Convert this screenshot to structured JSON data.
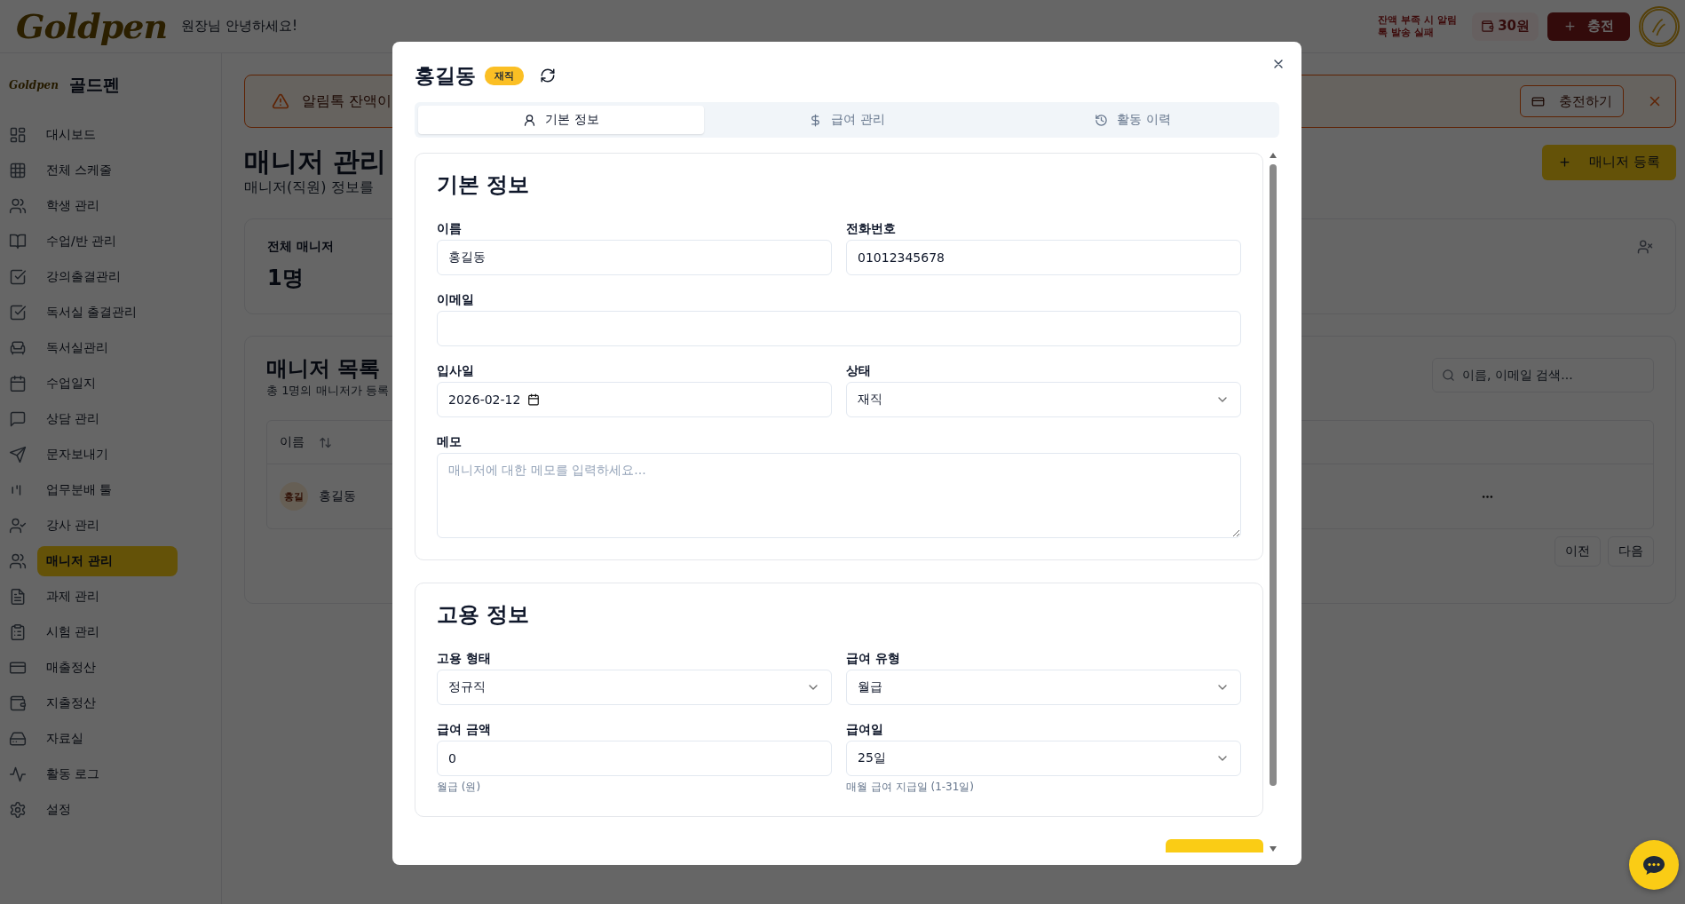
{
  "header": {
    "logo": "Goldpen",
    "greeting": "원장님 안녕하세요!",
    "balance_notice": "잔액 부족 시 알림톡 발송 실패",
    "balance": "30원",
    "charge_button": "충전"
  },
  "sidebar": {
    "logo": "Goldpen",
    "brand": "골드펜",
    "items": [
      {
        "label": "대시보드",
        "selected": false
      },
      {
        "label": "전체 스케줄",
        "selected": false
      },
      {
        "label": "학생 관리",
        "selected": false
      },
      {
        "label": "수업/반 관리",
        "selected": false
      },
      {
        "label": "강의출결관리",
        "selected": false
      },
      {
        "label": "독서실 출결관리",
        "selected": false
      },
      {
        "label": "독서실관리",
        "selected": false
      },
      {
        "label": "수업일지",
        "selected": false
      },
      {
        "label": "상담 관리",
        "selected": false
      },
      {
        "label": "문자보내기",
        "selected": false
      },
      {
        "label": "업무분배 툴",
        "selected": false
      },
      {
        "label": "강사 관리",
        "selected": false
      },
      {
        "label": "매니저 관리",
        "selected": true
      },
      {
        "label": "과제 관리",
        "selected": false
      },
      {
        "label": "시험 관리",
        "selected": false
      },
      {
        "label": "매출정산",
        "selected": false
      },
      {
        "label": "지출정산",
        "selected": false
      },
      {
        "label": "자료실",
        "selected": false
      },
      {
        "label": "활동 로그",
        "selected": false
      },
      {
        "label": "설정",
        "selected": false
      }
    ]
  },
  "alert": {
    "message": "알림톡 잔액이",
    "button": "충전하기"
  },
  "page": {
    "title": "매니저 관리",
    "subtitle": "매니저(직원) 정보를",
    "add_button": "매니저 등록"
  },
  "stats": [
    {
      "label": "전체 매니저",
      "value": "1명"
    }
  ],
  "manager_list": {
    "title": "매니저 목록",
    "subtitle": "총 1명의 매니저가 등록",
    "search": {
      "placeholder": "이름, 이메일 검색..."
    },
    "columns": [
      "이름"
    ],
    "rows": [
      {
        "avatar": "홍길",
        "name": "홍길동"
      }
    ],
    "pagination": [
      "이전",
      "다음"
    ]
  },
  "modal": {
    "title": "홍길동",
    "status": "재직",
    "tabs": [
      {
        "label": "기본 정보",
        "selected": true
      },
      {
        "label": "급여 관리",
        "selected": false
      },
      {
        "label": "활동 이력",
        "selected": false
      }
    ],
    "sections": [
      {
        "title": "기본 정보",
        "rows": [
          [
            {
              "kind": "text",
              "label": "이름",
              "value": "홍길동"
            },
            {
              "kind": "text",
              "label": "전화번호",
              "value": "01012345678"
            }
          ],
          [
            {
              "kind": "text",
              "label": "이메일"
            }
          ],
          [
            {
              "kind": "date",
              "label": "입사일",
              "value": "2026-02-12"
            },
            {
              "kind": "select",
              "label": "상태",
              "value": "재직"
            }
          ],
          [
            {
              "kind": "textarea",
              "label": "메모",
              "placeholder": "매니저에 대한 메모를 입력하세요..."
            }
          ]
        ]
      },
      {
        "title": "고용 정보",
        "rows": [
          [
            {
              "kind": "select",
              "label": "고용 형태",
              "value": "정규직"
            },
            {
              "kind": "select",
              "label": "급여 유형",
              "value": "월급"
            }
          ],
          [
            {
              "kind": "text",
              "label": "급여 금액",
              "value": "0",
              "hint": "월급 (원)"
            },
            {
              "kind": "select",
              "label": "급여일",
              "value": "25일",
              "hint": "매월 급여 지급일 (1-31일)"
            }
          ]
        ]
      }
    ]
  }
}
